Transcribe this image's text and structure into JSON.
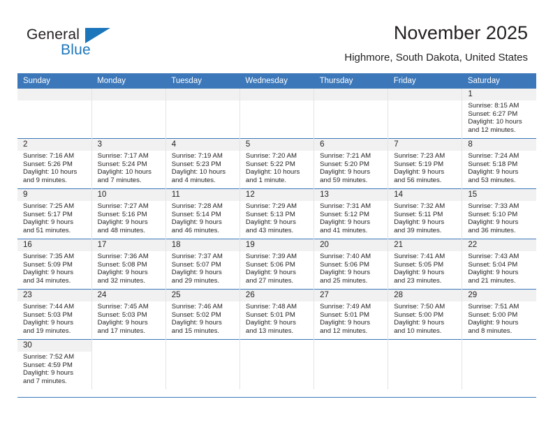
{
  "brand": {
    "name_part1": "General",
    "name_part2": "Blue",
    "accent_color": "#1b75bb"
  },
  "header": {
    "month_title": "November 2025",
    "location": "Highmore, South Dakota, United States"
  },
  "calendar": {
    "header_bg": "#3b77b9",
    "weekday_headers": [
      "Sunday",
      "Monday",
      "Tuesday",
      "Wednesday",
      "Thursday",
      "Friday",
      "Saturday"
    ],
    "weeks": [
      [
        {
          "day": "",
          "sunrise": "",
          "sunset": "",
          "daylight_line1": "",
          "daylight_line2": "",
          "empty": true
        },
        {
          "day": "",
          "sunrise": "",
          "sunset": "",
          "daylight_line1": "",
          "daylight_line2": "",
          "empty": true
        },
        {
          "day": "",
          "sunrise": "",
          "sunset": "",
          "daylight_line1": "",
          "daylight_line2": "",
          "empty": true
        },
        {
          "day": "",
          "sunrise": "",
          "sunset": "",
          "daylight_line1": "",
          "daylight_line2": "",
          "empty": true
        },
        {
          "day": "",
          "sunrise": "",
          "sunset": "",
          "daylight_line1": "",
          "daylight_line2": "",
          "empty": true
        },
        {
          "day": "",
          "sunrise": "",
          "sunset": "",
          "daylight_line1": "",
          "daylight_line2": "",
          "empty": true
        },
        {
          "day": "1",
          "sunrise": "Sunrise: 8:15 AM",
          "sunset": "Sunset: 6:27 PM",
          "daylight_line1": "Daylight: 10 hours",
          "daylight_line2": "and 12 minutes."
        }
      ],
      [
        {
          "day": "2",
          "sunrise": "Sunrise: 7:16 AM",
          "sunset": "Sunset: 5:26 PM",
          "daylight_line1": "Daylight: 10 hours",
          "daylight_line2": "and 9 minutes."
        },
        {
          "day": "3",
          "sunrise": "Sunrise: 7:17 AM",
          "sunset": "Sunset: 5:24 PM",
          "daylight_line1": "Daylight: 10 hours",
          "daylight_line2": "and 7 minutes."
        },
        {
          "day": "4",
          "sunrise": "Sunrise: 7:19 AM",
          "sunset": "Sunset: 5:23 PM",
          "daylight_line1": "Daylight: 10 hours",
          "daylight_line2": "and 4 minutes."
        },
        {
          "day": "5",
          "sunrise": "Sunrise: 7:20 AM",
          "sunset": "Sunset: 5:22 PM",
          "daylight_line1": "Daylight: 10 hours",
          "daylight_line2": "and 1 minute."
        },
        {
          "day": "6",
          "sunrise": "Sunrise: 7:21 AM",
          "sunset": "Sunset: 5:20 PM",
          "daylight_line1": "Daylight: 9 hours",
          "daylight_line2": "and 59 minutes."
        },
        {
          "day": "7",
          "sunrise": "Sunrise: 7:23 AM",
          "sunset": "Sunset: 5:19 PM",
          "daylight_line1": "Daylight: 9 hours",
          "daylight_line2": "and 56 minutes."
        },
        {
          "day": "8",
          "sunrise": "Sunrise: 7:24 AM",
          "sunset": "Sunset: 5:18 PM",
          "daylight_line1": "Daylight: 9 hours",
          "daylight_line2": "and 53 minutes."
        }
      ],
      [
        {
          "day": "9",
          "sunrise": "Sunrise: 7:25 AM",
          "sunset": "Sunset: 5:17 PM",
          "daylight_line1": "Daylight: 9 hours",
          "daylight_line2": "and 51 minutes."
        },
        {
          "day": "10",
          "sunrise": "Sunrise: 7:27 AM",
          "sunset": "Sunset: 5:16 PM",
          "daylight_line1": "Daylight: 9 hours",
          "daylight_line2": "and 48 minutes."
        },
        {
          "day": "11",
          "sunrise": "Sunrise: 7:28 AM",
          "sunset": "Sunset: 5:14 PM",
          "daylight_line1": "Daylight: 9 hours",
          "daylight_line2": "and 46 minutes."
        },
        {
          "day": "12",
          "sunrise": "Sunrise: 7:29 AM",
          "sunset": "Sunset: 5:13 PM",
          "daylight_line1": "Daylight: 9 hours",
          "daylight_line2": "and 43 minutes."
        },
        {
          "day": "13",
          "sunrise": "Sunrise: 7:31 AM",
          "sunset": "Sunset: 5:12 PM",
          "daylight_line1": "Daylight: 9 hours",
          "daylight_line2": "and 41 minutes."
        },
        {
          "day": "14",
          "sunrise": "Sunrise: 7:32 AM",
          "sunset": "Sunset: 5:11 PM",
          "daylight_line1": "Daylight: 9 hours",
          "daylight_line2": "and 39 minutes."
        },
        {
          "day": "15",
          "sunrise": "Sunrise: 7:33 AM",
          "sunset": "Sunset: 5:10 PM",
          "daylight_line1": "Daylight: 9 hours",
          "daylight_line2": "and 36 minutes."
        }
      ],
      [
        {
          "day": "16",
          "sunrise": "Sunrise: 7:35 AM",
          "sunset": "Sunset: 5:09 PM",
          "daylight_line1": "Daylight: 9 hours",
          "daylight_line2": "and 34 minutes."
        },
        {
          "day": "17",
          "sunrise": "Sunrise: 7:36 AM",
          "sunset": "Sunset: 5:08 PM",
          "daylight_line1": "Daylight: 9 hours",
          "daylight_line2": "and 32 minutes."
        },
        {
          "day": "18",
          "sunrise": "Sunrise: 7:37 AM",
          "sunset": "Sunset: 5:07 PM",
          "daylight_line1": "Daylight: 9 hours",
          "daylight_line2": "and 29 minutes."
        },
        {
          "day": "19",
          "sunrise": "Sunrise: 7:39 AM",
          "sunset": "Sunset: 5:06 PM",
          "daylight_line1": "Daylight: 9 hours",
          "daylight_line2": "and 27 minutes."
        },
        {
          "day": "20",
          "sunrise": "Sunrise: 7:40 AM",
          "sunset": "Sunset: 5:06 PM",
          "daylight_line1": "Daylight: 9 hours",
          "daylight_line2": "and 25 minutes."
        },
        {
          "day": "21",
          "sunrise": "Sunrise: 7:41 AM",
          "sunset": "Sunset: 5:05 PM",
          "daylight_line1": "Daylight: 9 hours",
          "daylight_line2": "and 23 minutes."
        },
        {
          "day": "22",
          "sunrise": "Sunrise: 7:43 AM",
          "sunset": "Sunset: 5:04 PM",
          "daylight_line1": "Daylight: 9 hours",
          "daylight_line2": "and 21 minutes."
        }
      ],
      [
        {
          "day": "23",
          "sunrise": "Sunrise: 7:44 AM",
          "sunset": "Sunset: 5:03 PM",
          "daylight_line1": "Daylight: 9 hours",
          "daylight_line2": "and 19 minutes."
        },
        {
          "day": "24",
          "sunrise": "Sunrise: 7:45 AM",
          "sunset": "Sunset: 5:03 PM",
          "daylight_line1": "Daylight: 9 hours",
          "daylight_line2": "and 17 minutes."
        },
        {
          "day": "25",
          "sunrise": "Sunrise: 7:46 AM",
          "sunset": "Sunset: 5:02 PM",
          "daylight_line1": "Daylight: 9 hours",
          "daylight_line2": "and 15 minutes."
        },
        {
          "day": "26",
          "sunrise": "Sunrise: 7:48 AM",
          "sunset": "Sunset: 5:01 PM",
          "daylight_line1": "Daylight: 9 hours",
          "daylight_line2": "and 13 minutes."
        },
        {
          "day": "27",
          "sunrise": "Sunrise: 7:49 AM",
          "sunset": "Sunset: 5:01 PM",
          "daylight_line1": "Daylight: 9 hours",
          "daylight_line2": "and 12 minutes."
        },
        {
          "day": "28",
          "sunrise": "Sunrise: 7:50 AM",
          "sunset": "Sunset: 5:00 PM",
          "daylight_line1": "Daylight: 9 hours",
          "daylight_line2": "and 10 minutes."
        },
        {
          "day": "29",
          "sunrise": "Sunrise: 7:51 AM",
          "sunset": "Sunset: 5:00 PM",
          "daylight_line1": "Daylight: 9 hours",
          "daylight_line2": "and 8 minutes."
        }
      ],
      [
        {
          "day": "30",
          "sunrise": "Sunrise: 7:52 AM",
          "sunset": "Sunset: 4:59 PM",
          "daylight_line1": "Daylight: 9 hours",
          "daylight_line2": "and 7 minutes."
        },
        {
          "day": "",
          "sunrise": "",
          "sunset": "",
          "daylight_line1": "",
          "daylight_line2": "",
          "blank": true
        },
        {
          "day": "",
          "sunrise": "",
          "sunset": "",
          "daylight_line1": "",
          "daylight_line2": "",
          "blank": true
        },
        {
          "day": "",
          "sunrise": "",
          "sunset": "",
          "daylight_line1": "",
          "daylight_line2": "",
          "blank": true
        },
        {
          "day": "",
          "sunrise": "",
          "sunset": "",
          "daylight_line1": "",
          "daylight_line2": "",
          "blank": true
        },
        {
          "day": "",
          "sunrise": "",
          "sunset": "",
          "daylight_line1": "",
          "daylight_line2": "",
          "blank": true
        },
        {
          "day": "",
          "sunrise": "",
          "sunset": "",
          "daylight_line1": "",
          "daylight_line2": "",
          "blank": true
        }
      ]
    ]
  }
}
